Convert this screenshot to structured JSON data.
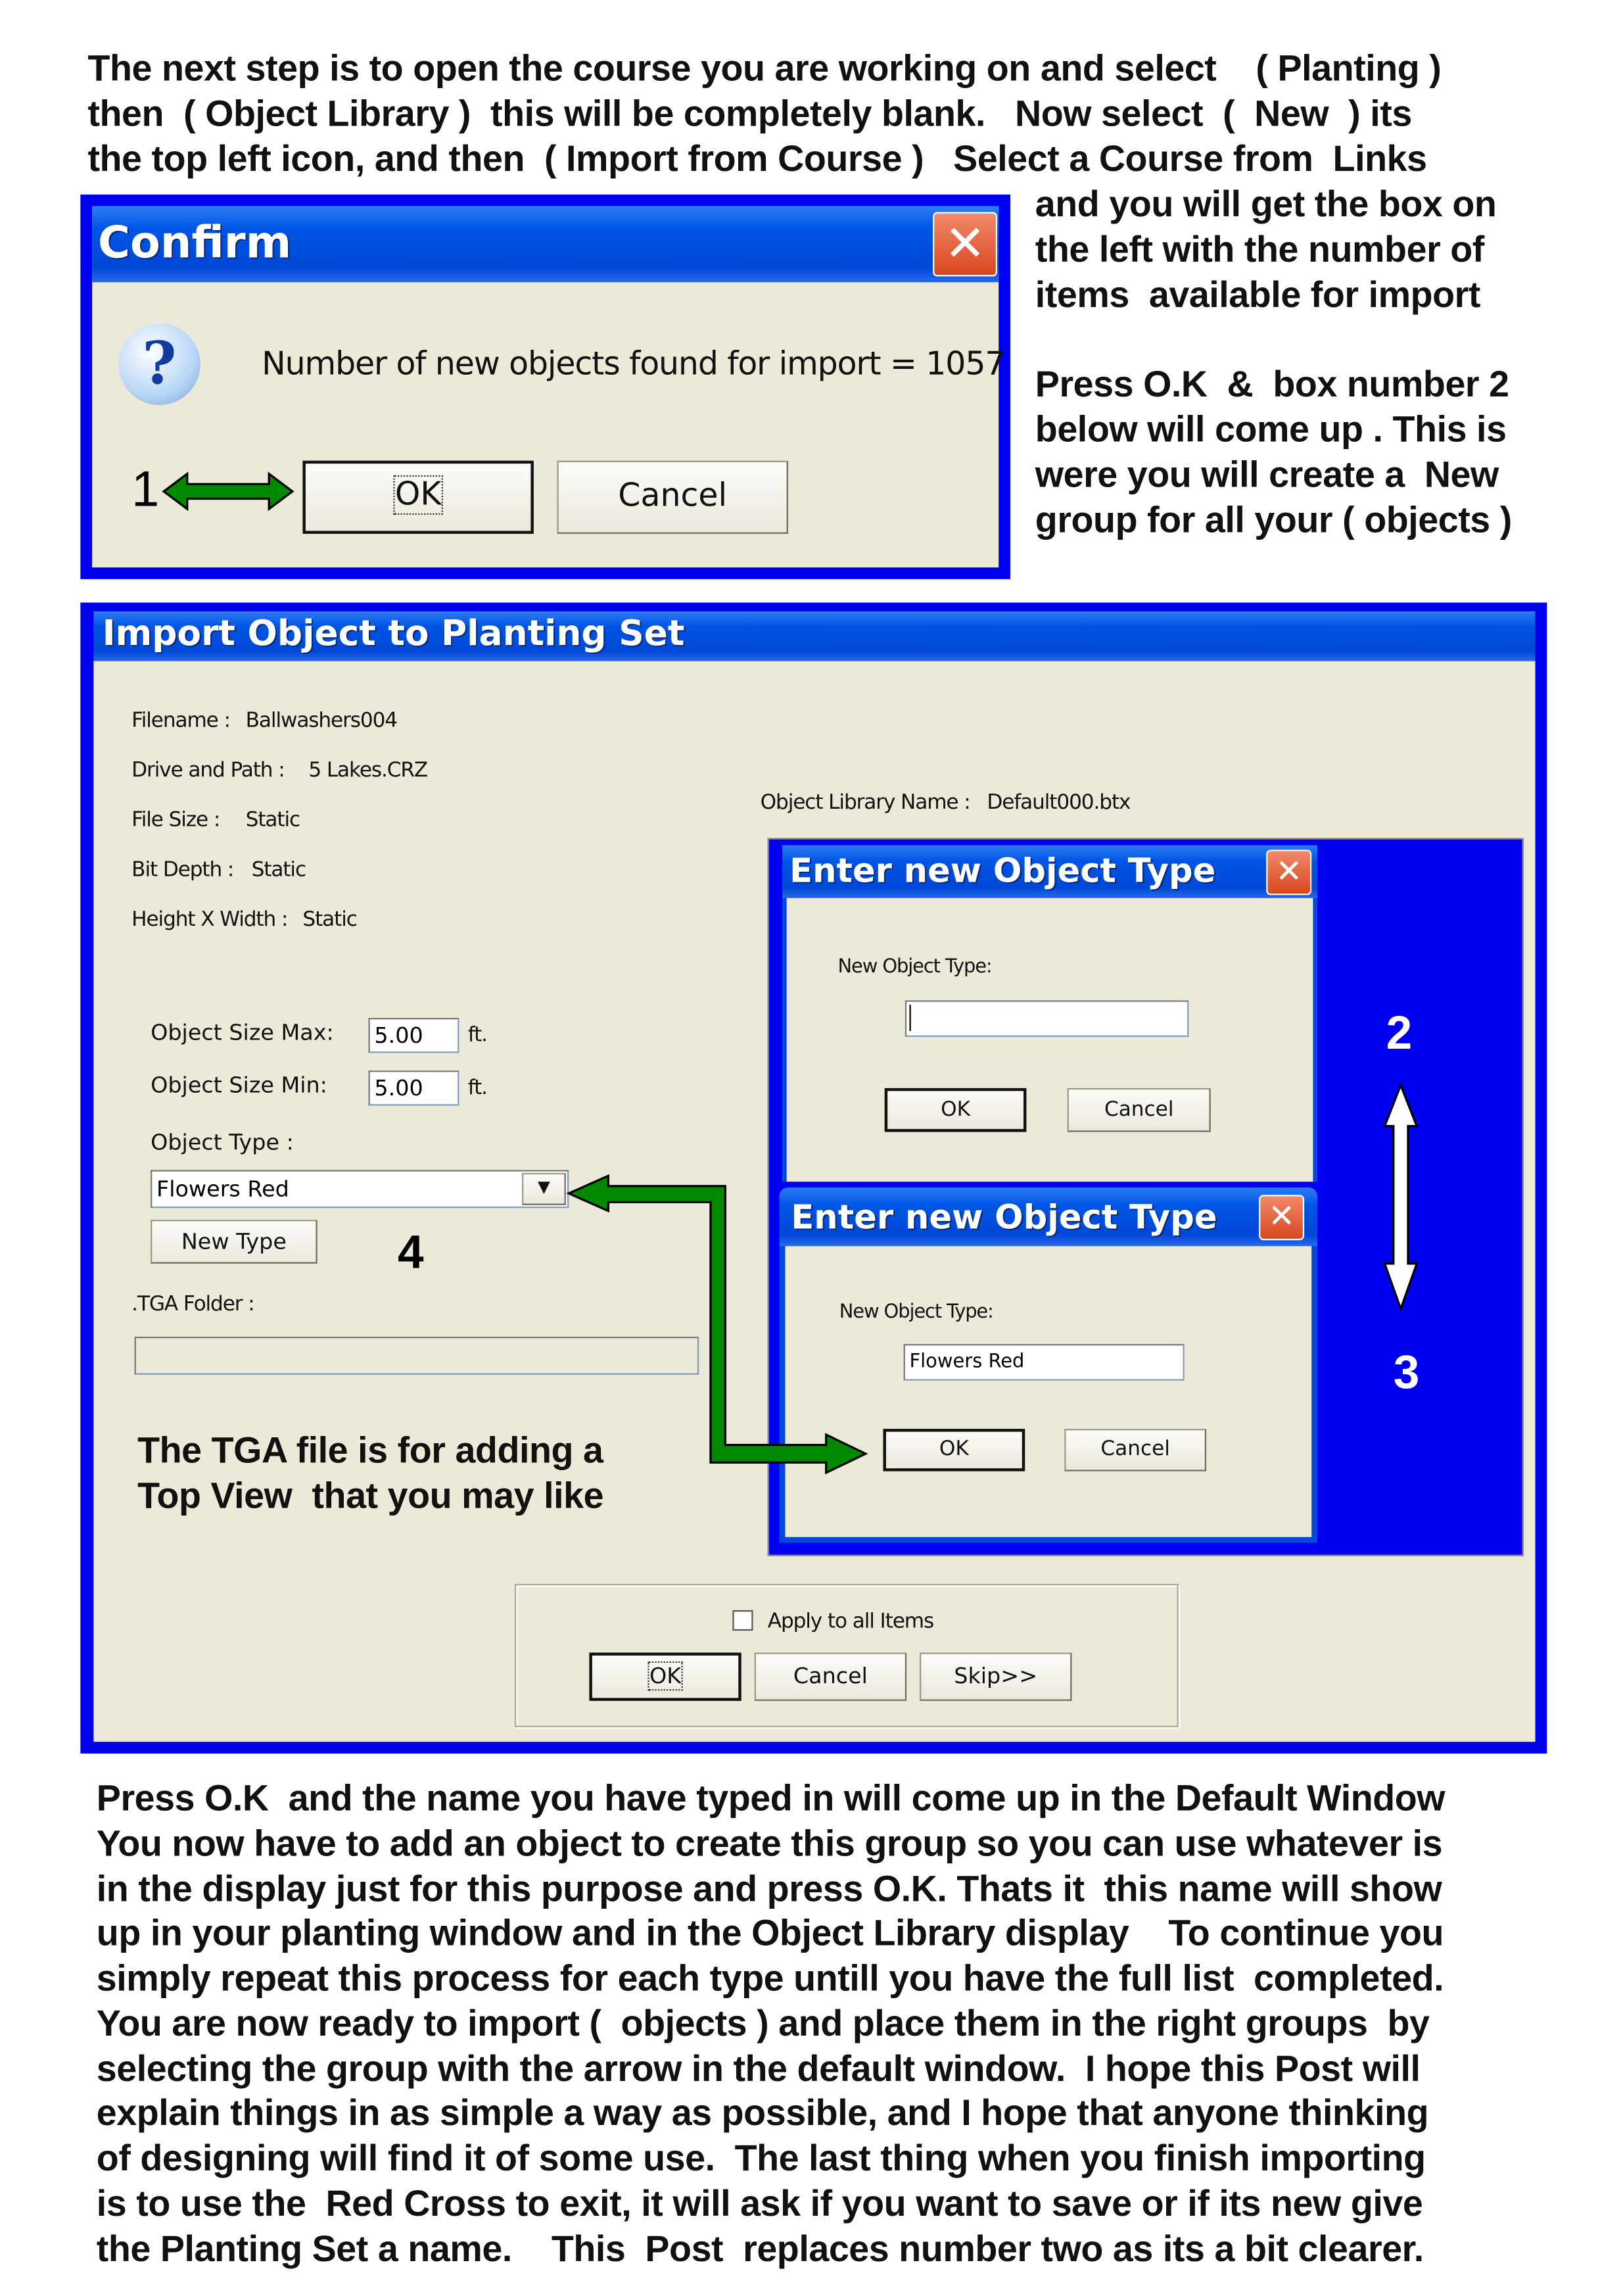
{
  "intro_lines": [
    "The next step is to open the course you are working on and select    ( Planting )",
    "then  ( Object Library )  this will be completely blank.   Now select  (  New  ) its",
    "the top left icon, and then  ( Import from Course )   Select a Course from  Links",
    "and you will get the box on",
    "the left with the number of",
    "items  available for import",
    "Press O.K  &  box number 2",
    "below will come up . This is",
    "were you will create a  New",
    "group for all your ( objects )"
  ],
  "confirm": {
    "title": "Confirm",
    "message": "Number of new objects found for import = 1057",
    "ok": "OK",
    "cancel": "Cancel",
    "step": "1",
    "icon": "question-icon"
  },
  "import_dialog": {
    "title": "Import Object to Planting Set",
    "filename_label": "Filename :",
    "filename": "Ballwashers004",
    "path_label": "Drive and Path :",
    "path": "5 Lakes.CRZ",
    "filesize_label": "File Size :",
    "filesize": "Static",
    "bitdepth_label": "Bit Depth :",
    "bitdepth": "Static",
    "hw_label": "Height X Width :",
    "hw": "Static",
    "library_label": "Object Library Name :",
    "library": "Default000.btx",
    "size_max_label": "Object Size Max:",
    "size_max": "5.00",
    "size_min_label": "Object Size Min:",
    "size_min": "5.00",
    "unit": "ft.",
    "type_label": "Object Type :",
    "type_value": "Flowers Red",
    "new_type": "New Type",
    "step4": "4",
    "tga_label": ".TGA Folder :",
    "tga_value": "",
    "tga_note_1": "The TGA file is for adding a",
    "tga_note_2": "Top View  that you may like",
    "apply_all": "Apply to all Items",
    "apply_all_checked": false,
    "ok": "OK",
    "cancel": "Cancel",
    "skip": "Skip>>"
  },
  "enter_dialog_1": {
    "title": "Enter new Object Type",
    "field_label": "New Object Type:",
    "value": "",
    "ok": "OK",
    "cancel": "Cancel",
    "step": "2"
  },
  "enter_dialog_2": {
    "title": "Enter new Object Type",
    "field_label": "New Object Type:",
    "value": "Flowers Red",
    "ok": "OK",
    "cancel": "Cancel",
    "step": "3"
  },
  "outro_lines": [
    "Press O.K  and the name you have typed in will come up in the Default Window",
    "You now have to add an object to create this group so you can use whatever is",
    "in the display just for this purpose and press O.K. Thats it  this name will show",
    "up in your planting window and in the Object Library display    To continue you",
    "simply repeat this process for each type untill you have the full list  completed.",
    "You are now ready to import (  objects ) and place them in the right groups  by",
    "selecting the group with the arrow in the default window.  I hope this Post will",
    "explain things in as simple a way as possible, and I hope that anyone thinking",
    "of designing will find it of some use.  The last thing when you finish importing",
    "is to use the  Red Cross to exit, it will ask if you want to save or if its new give",
    "the Planting Set a name.    This  Post  replaces number two as its a bit clearer."
  ],
  "colors": {
    "highlight_blue": "#0000f0",
    "arrow_green": "#008a00",
    "xp_face": "#ece9d8"
  }
}
